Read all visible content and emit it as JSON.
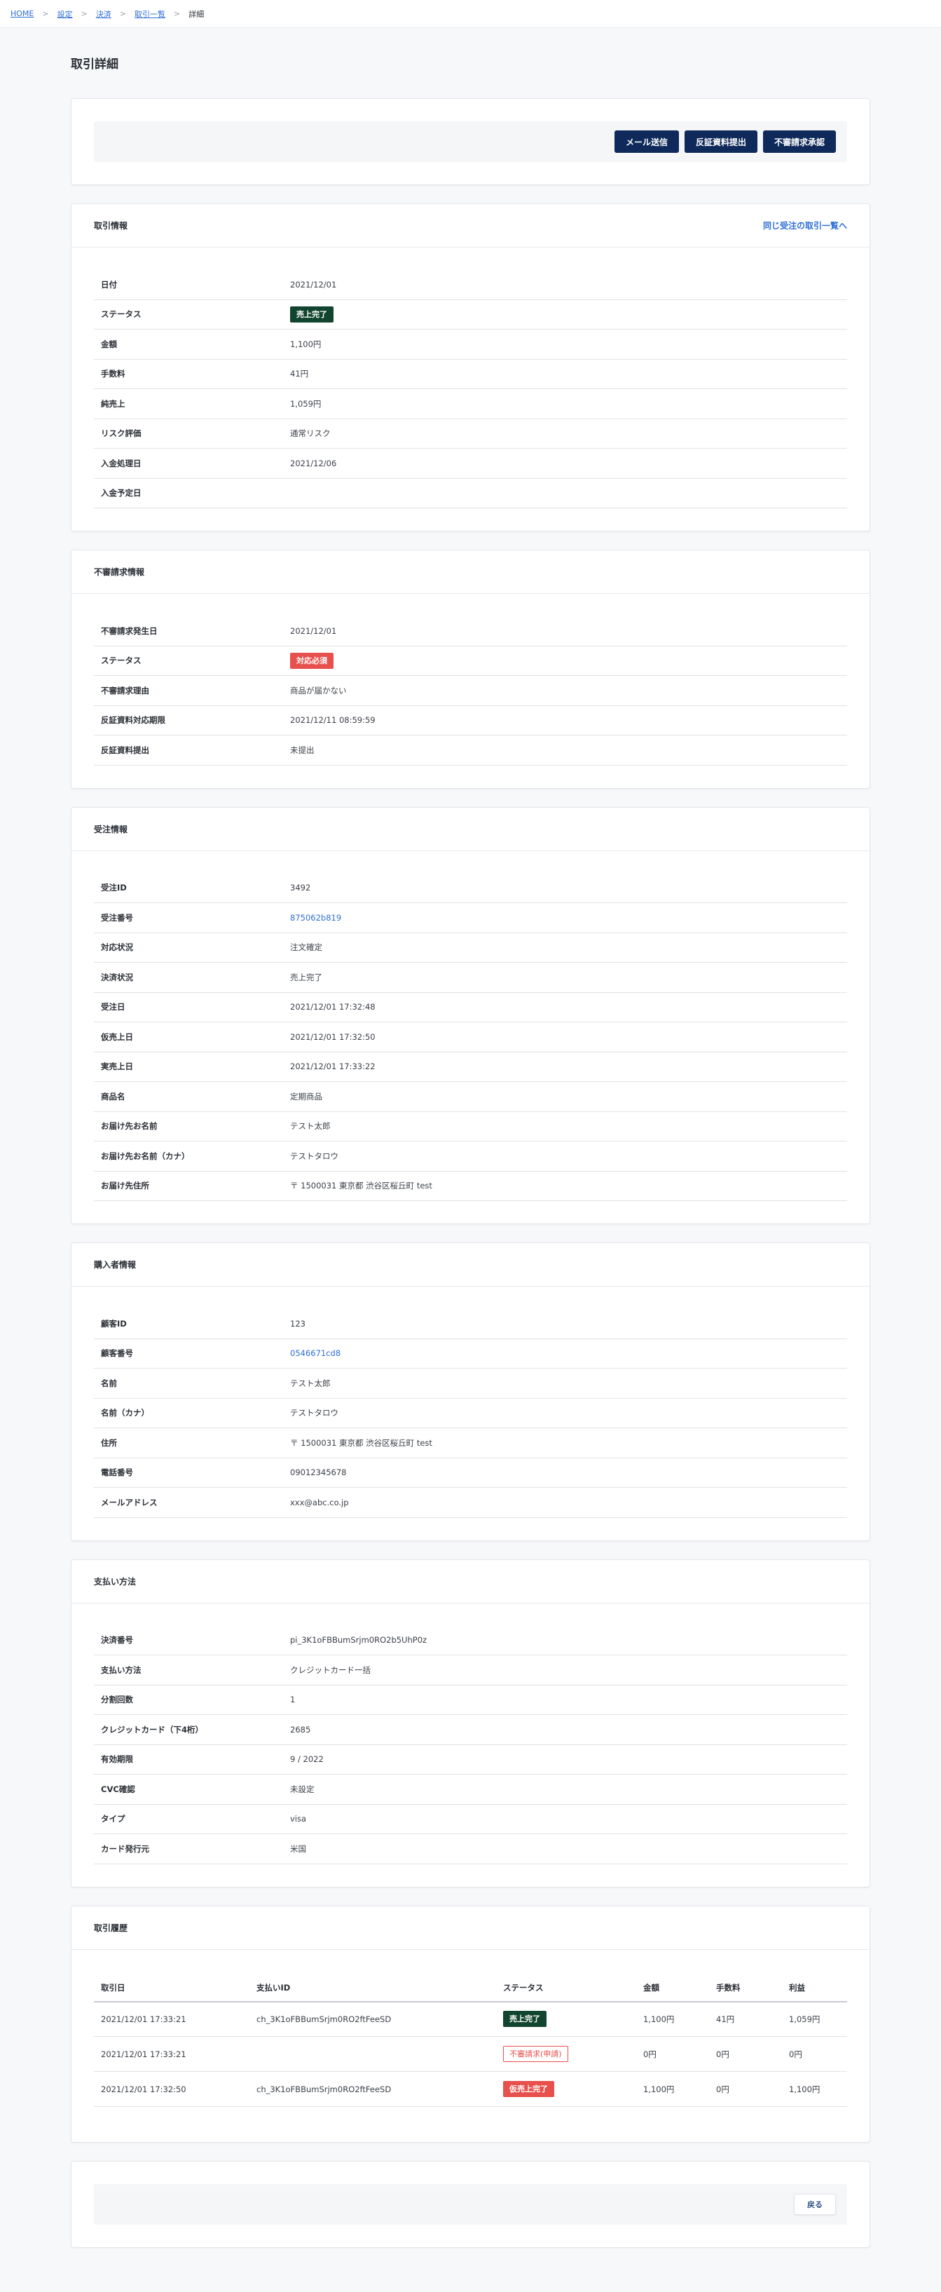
{
  "breadcrumb": {
    "items": [
      "HOME",
      "設定",
      "決済",
      "取引一覧"
    ],
    "current": "詳細"
  },
  "page_title": "取引詳細",
  "actions": {
    "send_mail": "メール送信",
    "submit_evidence": "反証資料提出",
    "accept_dispute": "不審請求承認"
  },
  "transaction": {
    "title": "取引情報",
    "link": "同じ受注の取引一覧へ",
    "rows": [
      {
        "label": "日付",
        "value": "2021/12/01"
      },
      {
        "label": "ステータス",
        "badge": "売上完了"
      },
      {
        "label": "金額",
        "value": "1,100円"
      },
      {
        "label": "手数料",
        "value": "41円"
      },
      {
        "label": "純売上",
        "value": "1,059円"
      },
      {
        "label": "リスク評価",
        "value": "通常リスク"
      },
      {
        "label": "入金処理日",
        "value": "2021/12/06"
      },
      {
        "label": "入金予定日",
        "value": ""
      }
    ]
  },
  "dispute": {
    "title": "不審請求情報",
    "rows": [
      {
        "label": "不審請求発生日",
        "value": "2021/12/01"
      },
      {
        "label": "ステータス",
        "badge": "対応必須"
      },
      {
        "label": "不審請求理由",
        "value": "商品が届かない"
      },
      {
        "label": "反証資料対応期限",
        "value": "2021/12/11 08:59:59"
      },
      {
        "label": "反証資料提出",
        "value": "未提出"
      }
    ]
  },
  "order": {
    "title": "受注情報",
    "rows": [
      {
        "label": "受注ID",
        "value": "3492"
      },
      {
        "label": "受注番号",
        "value": "875062b819"
      },
      {
        "label": "対応状況",
        "value": "注文確定"
      },
      {
        "label": "決済状況",
        "value": "売上完了"
      },
      {
        "label": "受注日",
        "value": "2021/12/01 17:32:48"
      },
      {
        "label": "仮売上日",
        "value": "2021/12/01 17:32:50"
      },
      {
        "label": "実売上日",
        "value": "2021/12/01 17:33:22"
      },
      {
        "label": "商品名",
        "value": "定期商品"
      },
      {
        "label": "お届け先お名前",
        "value": "テスト太郎"
      },
      {
        "label": "お届け先お名前（カナ）",
        "value": "テストタロウ"
      },
      {
        "label": "お届け先住所",
        "value": "〒 1500031 東京都 渋谷区桜丘町 test"
      }
    ]
  },
  "buyer": {
    "title": "購入者情報",
    "rows": [
      {
        "label": "顧客ID",
        "value": "123"
      },
      {
        "label": "顧客番号",
        "value": "0546671cd8"
      },
      {
        "label": "名前",
        "value": "テスト太郎"
      },
      {
        "label": "名前（カナ）",
        "value": "テストタロウ"
      },
      {
        "label": "住所",
        "value": "〒 1500031 東京都 渋谷区桜丘町 test"
      },
      {
        "label": "電話番号",
        "value": "09012345678"
      },
      {
        "label": "メールアドレス",
        "value": "xxx@abc.co.jp"
      }
    ]
  },
  "payment": {
    "title": "支払い方法",
    "rows": [
      {
        "label": "決済番号",
        "value": "pi_3K1oFBBumSrjm0RO2b5UhP0z"
      },
      {
        "label": "支払い方法",
        "value": "クレジットカード一括"
      },
      {
        "label": "分割回数",
        "value": "1"
      },
      {
        "label": "クレジットカード（下4桁）",
        "value": "2685"
      },
      {
        "label": "有効期限",
        "value": "9 / 2022"
      },
      {
        "label": "CVC確認",
        "value": "未設定"
      },
      {
        "label": "タイプ",
        "value": "visa"
      },
      {
        "label": "カード発行元",
        "value": "米国"
      }
    ]
  },
  "history": {
    "title": "取引履歴",
    "headers": [
      "取引日",
      "支払いID",
      "ステータス",
      "金額",
      "手数料",
      "利益"
    ],
    "rows": [
      {
        "date": "2021/12/01 17:33:21",
        "pay_id": "ch_3K1oFBBumSrjm0RO2ftFeeSD",
        "status": "売上完了",
        "amount": "1,100円",
        "fee": "41円",
        "profit": "1,059円"
      },
      {
        "date": "2021/12/01 17:33:21",
        "pay_id": "",
        "status": "不審請求(申請)",
        "amount": "0円",
        "fee": "0円",
        "profit": "0円"
      },
      {
        "date": "2021/12/01 17:32:50",
        "pay_id": "ch_3K1oFBBumSrjm0RO2ftFeeSD",
        "status": "仮売上完了",
        "amount": "1,100円",
        "fee": "0円",
        "profit": "1,100円"
      }
    ]
  },
  "footer": {
    "back_label": "戻る"
  }
}
